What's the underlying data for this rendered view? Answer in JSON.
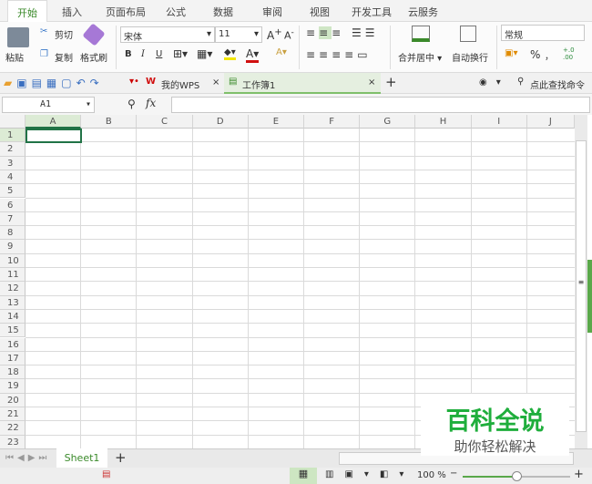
{
  "ribbon_tabs": [
    "开始",
    "插入",
    "页面布局",
    "公式",
    "数据",
    "审阅",
    "视图",
    "开发工具",
    "云服务"
  ],
  "clipboard": {
    "paste": "粘贴",
    "cut": "剪切",
    "copy": "复制",
    "format_painter": "格式刷"
  },
  "font": {
    "name": "宋体",
    "size": "11",
    "bold": "B",
    "italic": "I",
    "underline": "U"
  },
  "alignment": {
    "merge": "合并居中",
    "wrap": "自动换行"
  },
  "number": {
    "format": "常规",
    "percent": "%",
    "comma": "，",
    "dec": "+.0 .00"
  },
  "doc_tabs": [
    {
      "label": "我的WPS",
      "close": "×"
    },
    {
      "label": "工作簿1",
      "close": "×"
    }
  ],
  "add_tab": "+",
  "search_cmd": "点此查找命令",
  "formula": {
    "cell_ref": "A1",
    "fx": "fx",
    "value": ""
  },
  "columns": [
    "A",
    "B",
    "C",
    "D",
    "E",
    "F",
    "G",
    "H",
    "I",
    "J"
  ],
  "rows": [
    "1",
    "2",
    "3",
    "4",
    "5",
    "6",
    "7",
    "8",
    "9",
    "10",
    "11",
    "12",
    "13",
    "14",
    "15",
    "16",
    "17",
    "18",
    "19",
    "20",
    "21",
    "22",
    "23"
  ],
  "sheets": [
    "Sheet1"
  ],
  "add_sheet": "+",
  "zoom": "100 %",
  "zoom_percent": 100,
  "watermark": {
    "title": "百科全说",
    "subtitle": "助你轻松解决"
  },
  "colors": {
    "accent": "#3a8a2a",
    "selection": "#217346",
    "watermark": "#1fae3c"
  }
}
